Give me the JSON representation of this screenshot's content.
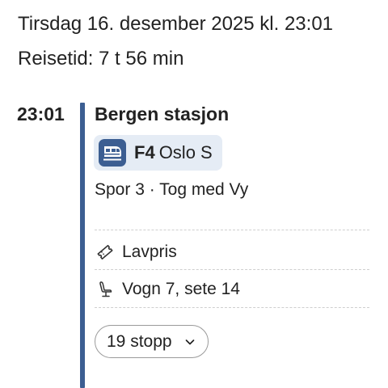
{
  "header": {
    "date_line": "Tirsdag 16. desember 2025 kl. 23:01",
    "duration_line": "Reisetid: 7 t 56 min"
  },
  "leg": {
    "departure_time": "23:01",
    "station": "Bergen stasjon",
    "line_code": "F4",
    "destination": "Oslo S",
    "platform_info": "Spor 3 · Tog med Vy",
    "line_icon": "train-icon",
    "accent_color": "#3c5e92",
    "chip_color": "#e5ecf5"
  },
  "details": {
    "ticket": {
      "icon": "ticket-icon",
      "label": "Lavpris"
    },
    "seat": {
      "icon": "seat-icon",
      "label": "Vogn 7, sete 14"
    }
  },
  "stops": {
    "label": "19 stopp",
    "icon": "chevron-down-icon"
  }
}
